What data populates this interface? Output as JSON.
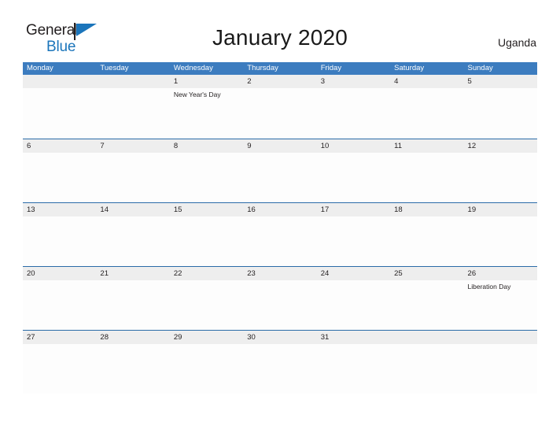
{
  "brand": {
    "name_part1": "General",
    "name_part2": "Blue",
    "flag_icon": "flag-triangle-icon"
  },
  "header": {
    "title": "January 2020",
    "country": "Uganda"
  },
  "colors": {
    "header_blue": "#3c7cbf",
    "divider_blue": "#2b6ca8",
    "date_band_gray": "#eeeeee",
    "brand_blue": "#1b75bb",
    "text_dark": "#231f20"
  },
  "calendar": {
    "weekdays": [
      "Monday",
      "Tuesday",
      "Wednesday",
      "Thursday",
      "Friday",
      "Saturday",
      "Sunday"
    ],
    "weeks": [
      [
        {
          "date": "",
          "event": ""
        },
        {
          "date": "",
          "event": ""
        },
        {
          "date": "1",
          "event": "New Year's Day"
        },
        {
          "date": "2",
          "event": ""
        },
        {
          "date": "3",
          "event": ""
        },
        {
          "date": "4",
          "event": ""
        },
        {
          "date": "5",
          "event": ""
        }
      ],
      [
        {
          "date": "6",
          "event": ""
        },
        {
          "date": "7",
          "event": ""
        },
        {
          "date": "8",
          "event": ""
        },
        {
          "date": "9",
          "event": ""
        },
        {
          "date": "10",
          "event": ""
        },
        {
          "date": "11",
          "event": ""
        },
        {
          "date": "12",
          "event": ""
        }
      ],
      [
        {
          "date": "13",
          "event": ""
        },
        {
          "date": "14",
          "event": ""
        },
        {
          "date": "15",
          "event": ""
        },
        {
          "date": "16",
          "event": ""
        },
        {
          "date": "17",
          "event": ""
        },
        {
          "date": "18",
          "event": ""
        },
        {
          "date": "19",
          "event": ""
        }
      ],
      [
        {
          "date": "20",
          "event": ""
        },
        {
          "date": "21",
          "event": ""
        },
        {
          "date": "22",
          "event": ""
        },
        {
          "date": "23",
          "event": ""
        },
        {
          "date": "24",
          "event": ""
        },
        {
          "date": "25",
          "event": ""
        },
        {
          "date": "26",
          "event": "Liberation Day"
        }
      ],
      [
        {
          "date": "27",
          "event": ""
        },
        {
          "date": "28",
          "event": ""
        },
        {
          "date": "29",
          "event": ""
        },
        {
          "date": "30",
          "event": ""
        },
        {
          "date": "31",
          "event": ""
        },
        {
          "date": "",
          "event": ""
        },
        {
          "date": "",
          "event": ""
        }
      ]
    ]
  }
}
